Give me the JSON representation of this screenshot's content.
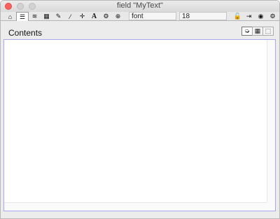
{
  "window": {
    "title": "field \"MyText\""
  },
  "toolbar": {
    "tools": [
      {
        "name": "home",
        "icon": "home-icon",
        "glyph": "⌂"
      },
      {
        "name": "properties",
        "icon": "list-icon",
        "glyph": "☰"
      },
      {
        "name": "database",
        "icon": "database-icon",
        "glyph": "≋"
      },
      {
        "name": "table",
        "icon": "table-icon",
        "glyph": "▦"
      },
      {
        "name": "pencil",
        "icon": "pencil-icon",
        "glyph": "✎"
      },
      {
        "name": "wand",
        "icon": "wand-icon",
        "glyph": "⁄"
      },
      {
        "name": "move",
        "icon": "move-icon",
        "glyph": "✛"
      },
      {
        "name": "text",
        "icon": "text-icon",
        "glyph": "A"
      },
      {
        "name": "gears",
        "icon": "gears-icon",
        "glyph": "⚙"
      },
      {
        "name": "geometry",
        "icon": "geometry-icon",
        "glyph": "⊕"
      },
      {
        "name": "lock",
        "icon": "lock-icon",
        "glyph": "🔓"
      },
      {
        "name": "enter",
        "icon": "enter-icon",
        "glyph": "⇥"
      },
      {
        "name": "target",
        "icon": "target-icon",
        "glyph": "◉"
      },
      {
        "name": "settings",
        "icon": "gear-icon",
        "glyph": "⚙"
      }
    ],
    "font_value": "font",
    "size_value": "18"
  },
  "section": {
    "title": "Contents",
    "view_buttons": [
      {
        "name": "code-view",
        "icon": "code-icon",
        "glyph": "➭"
      },
      {
        "name": "table-view",
        "icon": "table-icon",
        "glyph": "▦"
      },
      {
        "name": "tree-view",
        "icon": "tree-icon",
        "glyph": "⬚"
      }
    ]
  },
  "editor": {
    "text": ""
  },
  "colors": {
    "close_light": "#fc605c",
    "editor_border": "#a7a7f0"
  }
}
